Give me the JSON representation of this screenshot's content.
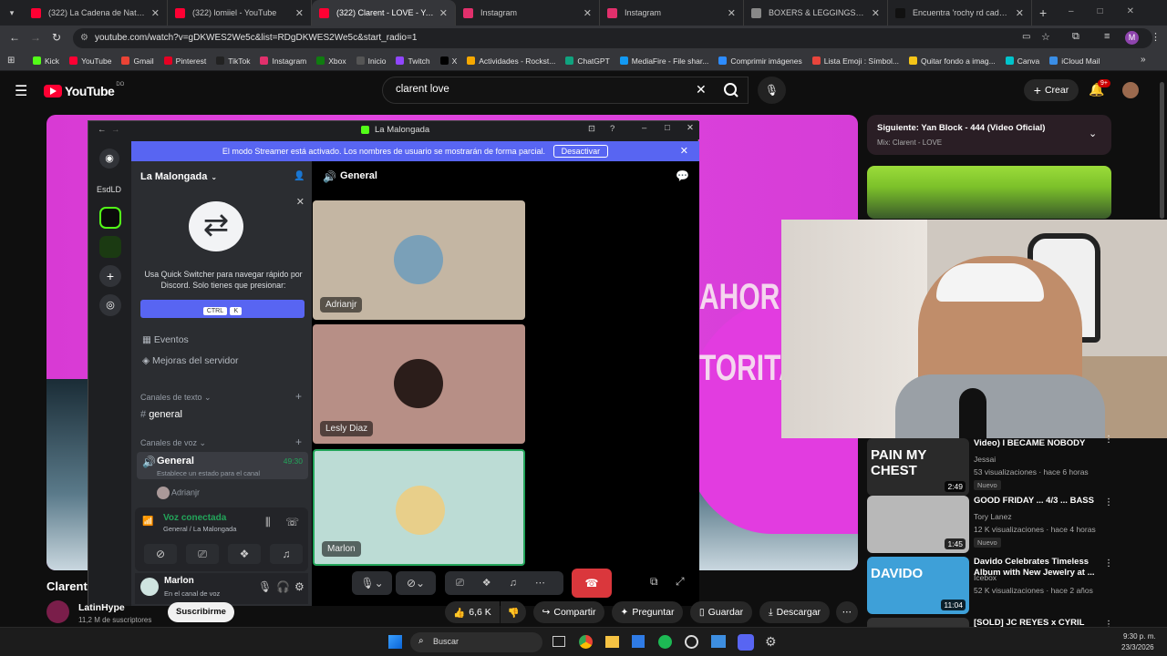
{
  "browser": {
    "tabs": [
      {
        "title": "(322) La Cadena de Natanael C",
        "color": "#ff0033"
      },
      {
        "title": "(322) lomiiel - YouTube",
        "color": "#ff0033"
      },
      {
        "title": "(322) Clarent - LOVE - YouTube",
        "color": "#ff0033"
      },
      {
        "title": "Instagram",
        "color": "#e1306c"
      },
      {
        "title": "Instagram",
        "color": "#e1306c"
      },
      {
        "title": "BOXERS & LEGGINGS | Chrome",
        "color": "#888888"
      },
      {
        "title": "Encuentra 'rochy rd cadena' en",
        "color": "#111111"
      }
    ],
    "url": "youtube.com/watch?v=gDKWES2We5c&list=RDgDKWES2We5c&start_radio=1",
    "bookmarks": [
      {
        "label": "Kick",
        "color": "#53fc18"
      },
      {
        "label": "YouTube",
        "color": "#ff0033"
      },
      {
        "label": "Gmail",
        "color": "#ea4335"
      },
      {
        "label": "Pinterest",
        "color": "#e60023"
      },
      {
        "label": "TikTok",
        "color": "#222222"
      },
      {
        "label": "Instagram",
        "color": "#e1306c"
      },
      {
        "label": "Xbox",
        "color": "#107c10"
      },
      {
        "label": "Inicio",
        "color": "#555555"
      },
      {
        "label": "Twitch",
        "color": "#9146ff"
      },
      {
        "label": "X",
        "color": "#000000"
      },
      {
        "label": "Actividades - Rockst...",
        "color": "#f6a800"
      },
      {
        "label": "ChatGPT",
        "color": "#10a37f"
      },
      {
        "label": "MediaFire - File shar...",
        "color": "#1299f3"
      },
      {
        "label": "Comprimir imágenes",
        "color": "#2d8cff"
      },
      {
        "label": "Lista Emoji : Símbol...",
        "color": "#e8453c"
      },
      {
        "label": "Quitar fondo a imag...",
        "color": "#f5c518"
      },
      {
        "label": "Canva",
        "color": "#00c4cc"
      },
      {
        "label": "iCloud Mail",
        "color": "#3a8ee6"
      }
    ],
    "profile_initial": "M"
  },
  "youtube": {
    "logo": "YouTube",
    "logo_sup": "DO",
    "search_value": "clarent love",
    "create_label": "Crear",
    "notif_count": "9+",
    "video_title": "Clarent",
    "channel_name": "LatinHype",
    "subscribers": "11,2 M de suscriptores",
    "subscribe_label": "Suscribirme",
    "likes": "6,6 K",
    "share_label": "Compartir",
    "ask_label": "Preguntar",
    "save_label": "Guardar",
    "download_label": "Descargar",
    "overlay_text_1": "AHORIT",
    "overlay_text_2": "TORITA",
    "next": {
      "label": "Siguiente: Yan Block - 444 (Video Oficial)",
      "mix": "Mix: Clarent - LOVE"
    },
    "recs": [
      {
        "title": "Video) I BECAME NOBODY",
        "channel": "Jessai",
        "meta": "53 visualizaciones · hace 6 horas",
        "badge": "Nuevo",
        "duration": "2:49",
        "thumb_text": "PAIN MY CHEST"
      },
      {
        "title": "GOOD FRIDAY ... 4/3 ... BASS",
        "channel": "Tory Lanez",
        "meta": "12 K visualizaciones · hace 4 horas",
        "badge": "Nuevo",
        "duration": "1:45",
        "thumb_text": ""
      },
      {
        "title": "Davido Celebrates Timeless Album with New Jewelry at ...",
        "channel": "Icebox",
        "meta": "52 K visualizaciones · hace 2 años",
        "badge": "",
        "duration": "11:04",
        "thumb_text": "DAVIDO"
      },
      {
        "title": "[SOLD] JC REYES x CYRIL",
        "channel": "",
        "meta": "",
        "badge": "",
        "duration": "",
        "thumb_text": ""
      }
    ]
  },
  "discord": {
    "window_title": "La Malongada",
    "streamer_notice": "El modo Streamer está activado. Los nombres de usuario se mostrarán de forma parcial.",
    "deactivate_label": "Desactivar",
    "rail_label": "EsdLD",
    "server_name": "La Malongada",
    "quick_switcher_text": "Usa Quick Switcher para navegar rápido por Discord. Solo tienes que presionar:",
    "key_ctrl": "CTRL",
    "key_k": "K",
    "events_label": "Eventos",
    "boosts_label": "Mejoras del servidor",
    "text_channels_label": "Canales de texto",
    "text_channel": "general",
    "voice_channels_label": "Canales de voz",
    "voice_channel": "General",
    "voice_timer": "49:30",
    "voice_status": "Establece un estado para el canal",
    "voice_member": "Adrianjr",
    "connected_label": "Voz conectada",
    "connected_sub": "General / La Malongada",
    "user_name": "Marlon",
    "user_status": "En el canal de voz",
    "channel_header": "General",
    "tiles": [
      {
        "name": "Adrianjr",
        "bg": "#c4b6a3"
      },
      {
        "name": "Lesly Diaz",
        "bg": "#b78f86"
      },
      {
        "name": "Marlon",
        "bg": "#bcdcd5"
      }
    ]
  },
  "taskbar": {
    "search_label": "Buscar",
    "time": "9:30 p. m.",
    "date": "23/3/2026"
  }
}
